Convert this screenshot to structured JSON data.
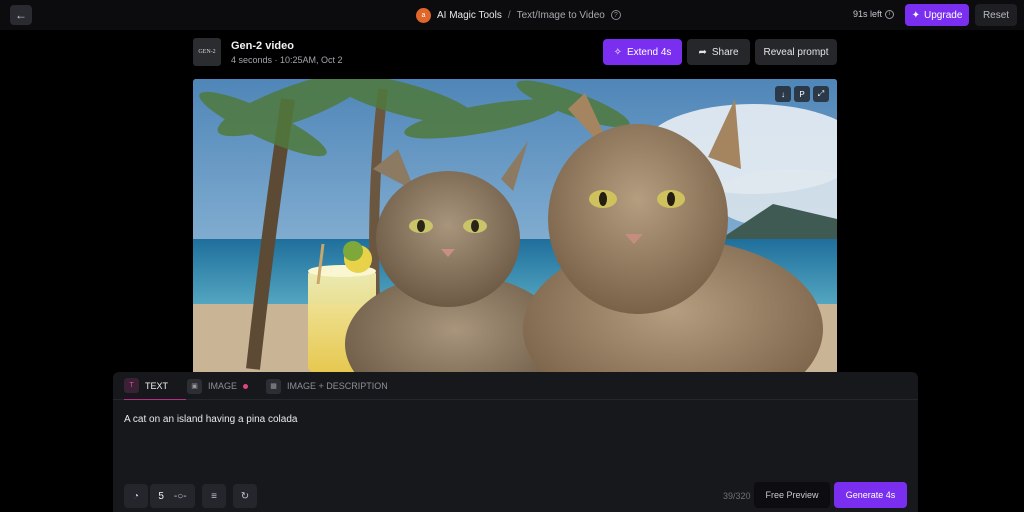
{
  "topbar": {
    "back_icon": "arrow-left-icon",
    "breadcrumb_logo_letter": "a",
    "breadcrumb_main": "AI Magic Tools",
    "breadcrumb_sep": "/",
    "breadcrumb_sub": "Text/Image to Video",
    "credits": "91s left",
    "upgrade_label": "Upgrade",
    "reset_label": "Reset"
  },
  "video_header": {
    "thumb_text": "GEN-2",
    "title": "Gen-2 video",
    "meta": "4 seconds · 10:25AM, Oct 2",
    "extend_label": "Extend 4s",
    "share_label": "Share",
    "reveal_label": "Reveal prompt"
  },
  "video_tools": [
    "download-icon",
    "pin-icon",
    "fullscreen-icon"
  ],
  "tabs": [
    {
      "label": "TEXT",
      "active": true
    },
    {
      "label": "IMAGE",
      "active": false
    },
    {
      "label": "IMAGE + DESCRIPTION",
      "active": false
    }
  ],
  "prompt": "A cat on an island having a pina colada",
  "controls": {
    "seed_value": "5",
    "char_count": "39/320",
    "preview_label": "Free Preview",
    "generate_label": "Generate 4s"
  },
  "colors": {
    "accent": "#7a2ff0",
    "tab_underline": "#b52f8a",
    "panel_bg": "#17181c"
  }
}
